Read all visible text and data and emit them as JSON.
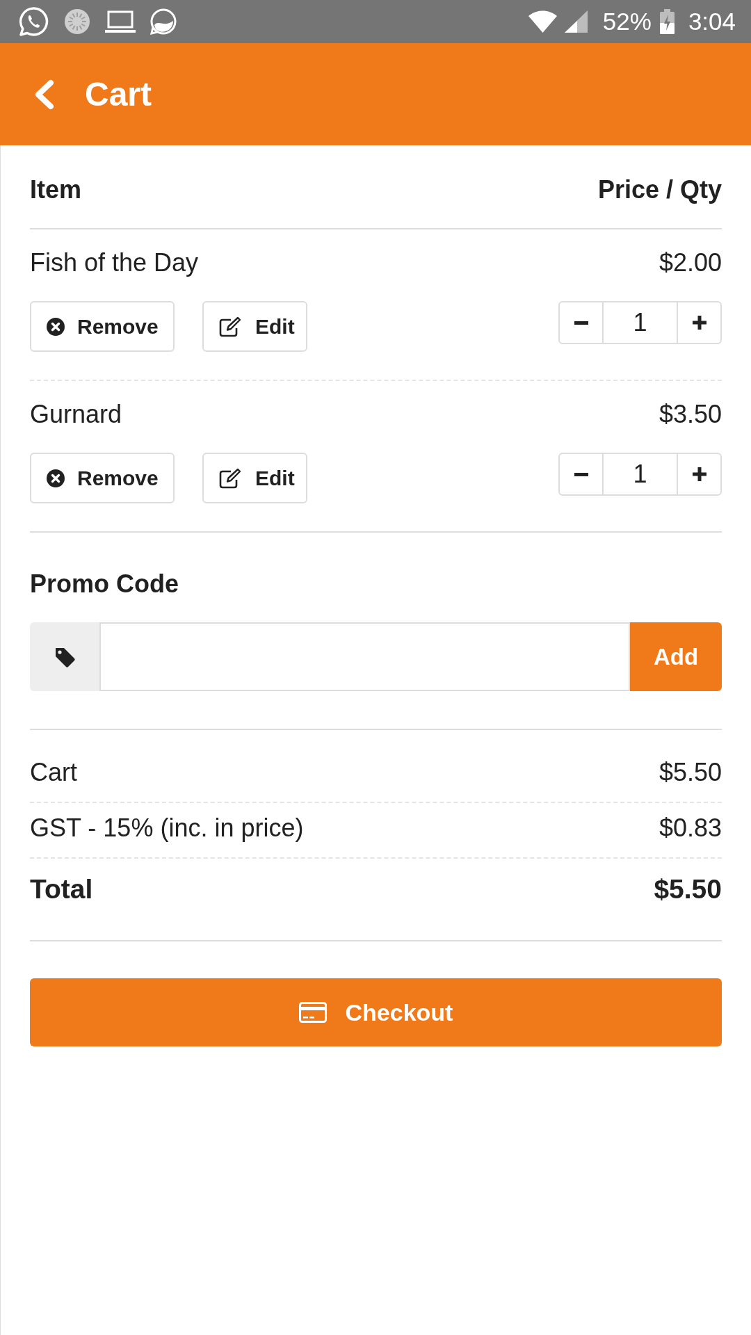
{
  "status_bar": {
    "battery": "52%",
    "time": "3:04"
  },
  "app_bar": {
    "title": "Cart"
  },
  "cart_table": {
    "columns": [
      "Item",
      "Price / Qty"
    ],
    "items": [
      {
        "name": "Fish of the Day",
        "price": "$2.00",
        "quantity": "1",
        "actions": [
          {
            "kind": "remove",
            "label": "Remove"
          },
          {
            "kind": "edit",
            "label": "Edit"
          }
        ]
      },
      {
        "name": "Gurnard",
        "price": "$3.50",
        "quantity": "1",
        "actions": [
          {
            "kind": "remove",
            "label": "Remove"
          },
          {
            "kind": "edit",
            "label": "Edit"
          }
        ]
      }
    ]
  },
  "promo_code": {
    "label": "Promo Code",
    "button": "Add"
  },
  "summary": [
    {
      "kind": "line",
      "label": "Cart",
      "value": "$5.50"
    },
    {
      "kind": "line",
      "label": "GST - 15% (inc. in price)",
      "value": "$0.83"
    },
    {
      "kind": "total",
      "label": "Total",
      "value": "$5.50"
    }
  ],
  "checkout_button": {
    "label": "Checkout"
  }
}
